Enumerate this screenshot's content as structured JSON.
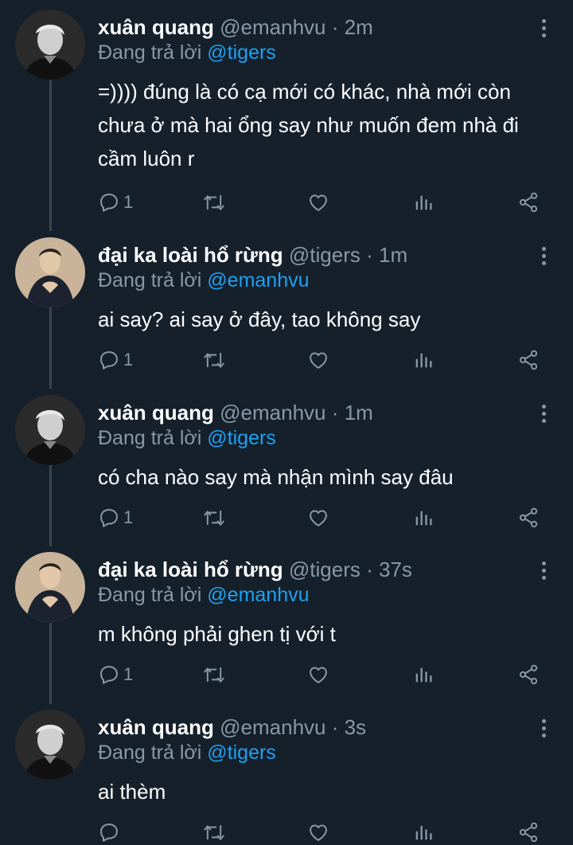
{
  "colors": {
    "background": "#15202b",
    "thread_line": "#38444d",
    "secondary_text": "#8899a6",
    "mention": "#1da1f2",
    "primary_text": "#ffffff"
  },
  "labels": {
    "replying_prefix": "Đang trả lời",
    "dot": "·"
  },
  "tweets": [
    {
      "name": "xuân quang",
      "handle": "@emanhvu",
      "time": "2m",
      "reply_to": "@tigers",
      "text": "=)))) đúng là có cạ mới có khác, nhà mới còn chưa ở mà hai ổng say như muốn đem nhà đi cầm luôn r",
      "reply_count": "1",
      "avatar": "avatar-xuan-quang"
    },
    {
      "name": "đại ka loài hổ rừng",
      "handle": "@tigers",
      "time": "1m",
      "reply_to": "@emanhvu",
      "text": "ai say? ai say ở đây, tao không say",
      "reply_count": "1",
      "avatar": "avatar-tigers"
    },
    {
      "name": "xuân quang",
      "handle": "@emanhvu",
      "time": "1m",
      "reply_to": "@tigers",
      "text": "có cha nào say mà nhận mình say đâu",
      "reply_count": "1",
      "avatar": "avatar-xuan-quang"
    },
    {
      "name": "đại ka loài hổ rừng",
      "handle": "@tigers",
      "time": "37s",
      "reply_to": "@emanhvu",
      "text": "m không phải ghen tị với t",
      "reply_count": "1",
      "avatar": "avatar-tigers"
    },
    {
      "name": "xuân quang",
      "handle": "@emanhvu",
      "time": "3s",
      "reply_to": "@tigers",
      "text": "ai thèm",
      "reply_count": "",
      "avatar": "avatar-xuan-quang"
    }
  ],
  "icons": [
    "reply-icon",
    "retweet-icon",
    "like-icon",
    "analytics-icon",
    "share-icon",
    "more-options-icon"
  ]
}
